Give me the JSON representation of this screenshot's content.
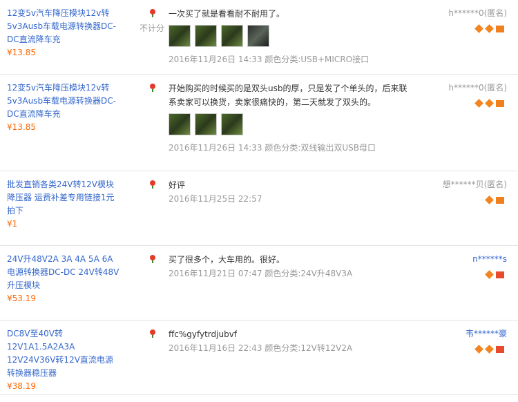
{
  "reviews": [
    {
      "product_title": "12变5v汽车降压模块12v转5v3Ausb车载电源转换器DC-DC直流降车充",
      "price": "¥13.85",
      "nocount": "不计分",
      "text": "一次买了就是看看耐不耐用了。",
      "date": "2016年11月26日 14:33",
      "color_cat": "颜色分类:USB+MICRO接口",
      "user": "h******0(匿名)",
      "thumbs": 4
    },
    {
      "product_title": "12变5v汽车降压模块12v转5v3Ausb车载电源转换器DC-DC直流降车充",
      "price": "¥13.85",
      "nocount": "",
      "text": "开始购买的时候买的是双头usb的厚，只是发了个单头的，后来联系卖家可以换货，卖家很痛快的，第二天就发了双头的。",
      "date": "2016年11月26日 14:33",
      "color_cat": "颜色分类:双线输出双USB母口",
      "user": "h******0(匿名)",
      "thumbs": 3
    },
    {
      "product_title": "批发直销各类24V转12V模块降压器 运费补差专用链接1元拍下",
      "price": "¥1",
      "nocount": "",
      "text": "好评",
      "date": "2016年11月25日 22:57",
      "color_cat": "",
      "user": "想******贝(匿名)",
      "thumbs": 0
    },
    {
      "product_title": "24V升48V2A 3A 4A 5A 6A电源转换器DC-DC 24V转48V升压模块",
      "price": "¥53.19",
      "nocount": "",
      "text": "买了很多个，大车用的。很好。",
      "date": "2016年11月21日 07:47",
      "color_cat": "颜色分类:24V升48V3A",
      "user": "n******s",
      "thumbs": 0
    },
    {
      "product_title": "DC8V至40V转12V1A1.5A2A3A 12V24V36V转12V直流电源转换器稳压器",
      "price": "¥38.19",
      "nocount": "",
      "text": "ffc%gyfytrdjubvf",
      "date": "2016年11月16日 22:43",
      "color_cat": "颜色分类:12V转12V2A",
      "user": "韦******豪",
      "thumbs": 0
    }
  ],
  "icons": {
    "rating": "flower-icon",
    "credit": "diamond-icon",
    "vip": "badge-icon"
  }
}
